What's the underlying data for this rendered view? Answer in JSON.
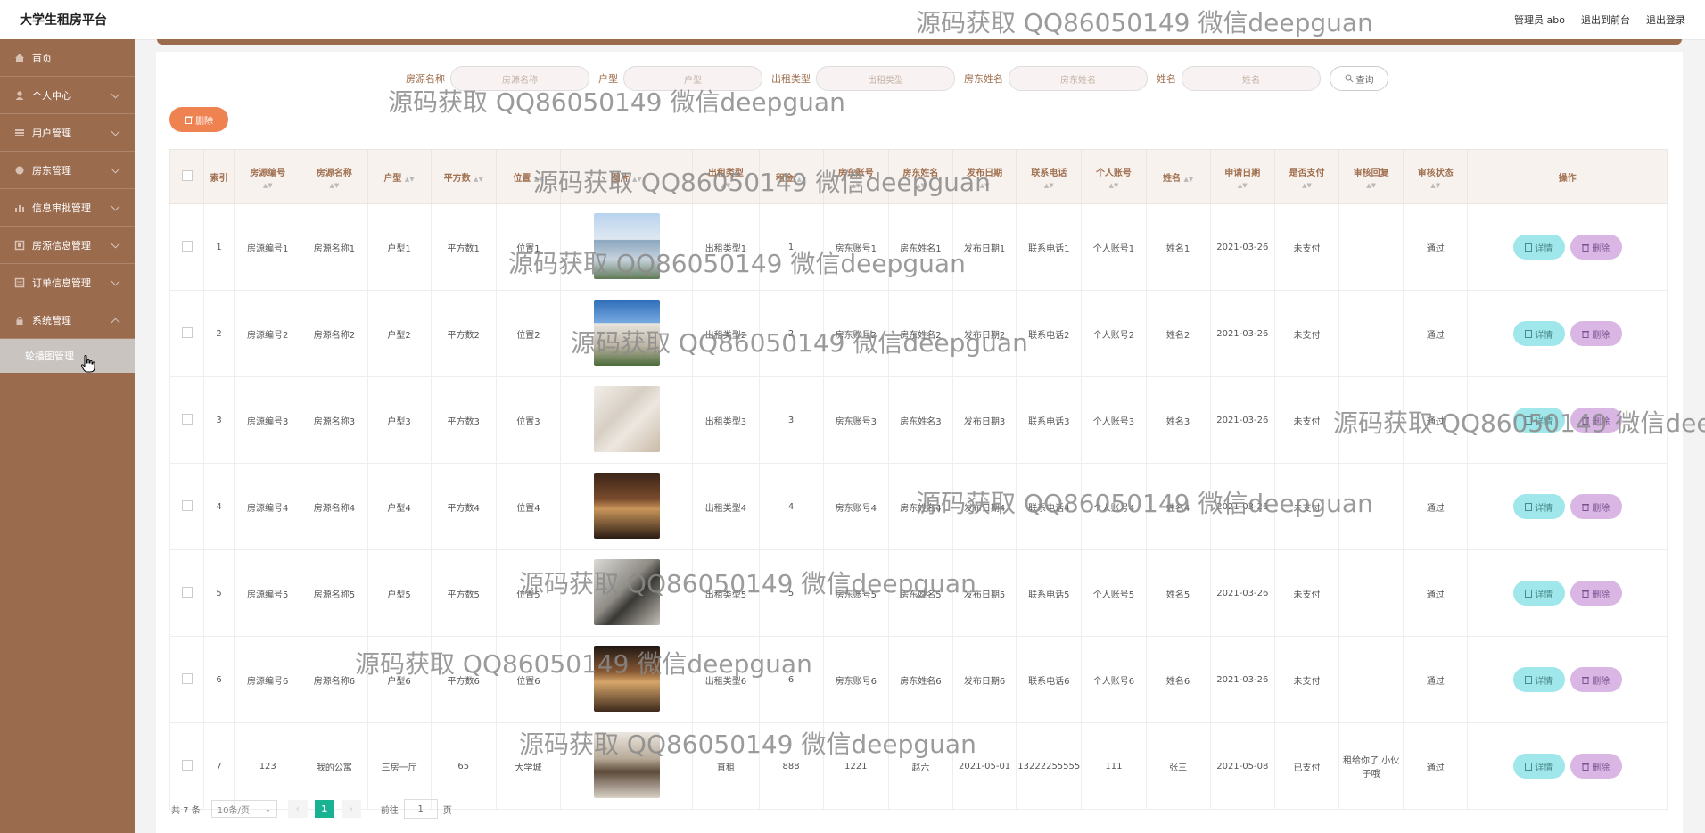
{
  "header": {
    "title": "大学生租房平台",
    "admin_label": "管理员 abo",
    "front_label": "退出到前台",
    "logout_label": "退出登录"
  },
  "watermark": "源码获取 QQ86050149 微信deepguan",
  "sidebar": {
    "items": [
      {
        "label": "首页",
        "icon": "home-icon"
      },
      {
        "label": "个人中心",
        "icon": "user-icon"
      },
      {
        "label": "用户管理",
        "icon": "users-icon"
      },
      {
        "label": "房东管理",
        "icon": "badge-icon"
      },
      {
        "label": "信息审批管理",
        "icon": "chart-icon"
      },
      {
        "label": "房源信息管理",
        "icon": "house-icon"
      },
      {
        "label": "订单信息管理",
        "icon": "order-icon"
      },
      {
        "label": "系统管理",
        "icon": "lock-icon"
      }
    ],
    "sub_item": "轮播图管理"
  },
  "search": {
    "fields": [
      {
        "label": "房源名称",
        "placeholder": "房源名称"
      },
      {
        "label": "户型",
        "placeholder": "户型"
      },
      {
        "label": "出租类型",
        "placeholder": "出租类型"
      },
      {
        "label": "房东姓名",
        "placeholder": "房东姓名"
      },
      {
        "label": "姓名",
        "placeholder": "姓名"
      }
    ],
    "query_label": "查询"
  },
  "toolbar": {
    "delete_label": "删除"
  },
  "table": {
    "headers": [
      "索引",
      "房源编号",
      "房源名称",
      "户型",
      "平方数",
      "位置",
      "图片",
      "出租类型",
      "租金",
      "房东账号",
      "房东姓名",
      "发布日期",
      "联系电话",
      "个人账号",
      "姓名",
      "申请日期",
      "是否支付",
      "审核回复",
      "审核状态",
      "操作"
    ],
    "rows": [
      [
        "1",
        "房源编号1",
        "房源名称1",
        "户型1",
        "平方数1",
        "位置1",
        "",
        "出租类型1",
        "1",
        "房东账号1",
        "房东姓名1",
        "发布日期1",
        "联系电话1",
        "个人账号1",
        "姓名1",
        "2021-03-26",
        "未支付",
        "",
        "通过"
      ],
      [
        "2",
        "房源编号2",
        "房源名称2",
        "户型2",
        "平方数2",
        "位置2",
        "",
        "出租类型2",
        "2",
        "房东账号2",
        "房东姓名2",
        "发布日期2",
        "联系电话2",
        "个人账号2",
        "姓名2",
        "2021-03-26",
        "未支付",
        "",
        "通过"
      ],
      [
        "3",
        "房源编号3",
        "房源名称3",
        "户型3",
        "平方数3",
        "位置3",
        "",
        "出租类型3",
        "3",
        "房东账号3",
        "房东姓名3",
        "发布日期3",
        "联系电话3",
        "个人账号3",
        "姓名3",
        "2021-03-26",
        "未支付",
        "",
        "通过"
      ],
      [
        "4",
        "房源编号4",
        "房源名称4",
        "户型4",
        "平方数4",
        "位置4",
        "",
        "出租类型4",
        "4",
        "房东账号4",
        "房东姓名4",
        "发布日期4",
        "联系电话4",
        "个人账号4",
        "姓名4",
        "2021-03-26",
        "未支付",
        "",
        "通过"
      ],
      [
        "5",
        "房源编号5",
        "房源名称5",
        "户型5",
        "平方数5",
        "位置5",
        "",
        "出租类型5",
        "5",
        "房东账号5",
        "房东姓名5",
        "发布日期5",
        "联系电话5",
        "个人账号5",
        "姓名5",
        "2021-03-26",
        "未支付",
        "",
        "通过"
      ],
      [
        "6",
        "房源编号6",
        "房源名称6",
        "户型6",
        "平方数6",
        "位置6",
        "",
        "出租类型6",
        "6",
        "房东账号6",
        "房东姓名6",
        "发布日期6",
        "联系电话6",
        "个人账号6",
        "姓名6",
        "2021-03-26",
        "未支付",
        "",
        "通过"
      ],
      [
        "7",
        "123",
        "我的公寓",
        "三房一厅",
        "65",
        "大学城",
        "",
        "直租",
        "888",
        "1221",
        "赵六",
        "2021-05-01",
        "13222255555",
        "111",
        "张三",
        "2021-05-08",
        "已支付",
        "租给你了,小伙子哦",
        "通过"
      ]
    ],
    "detail_label": "详情",
    "delete_label": "删除"
  },
  "pager": {
    "total": "共 7 条",
    "page_size": "10条/页",
    "current": "1",
    "goto_prefix": "前往",
    "goto_value": "1",
    "goto_suffix": "页"
  }
}
